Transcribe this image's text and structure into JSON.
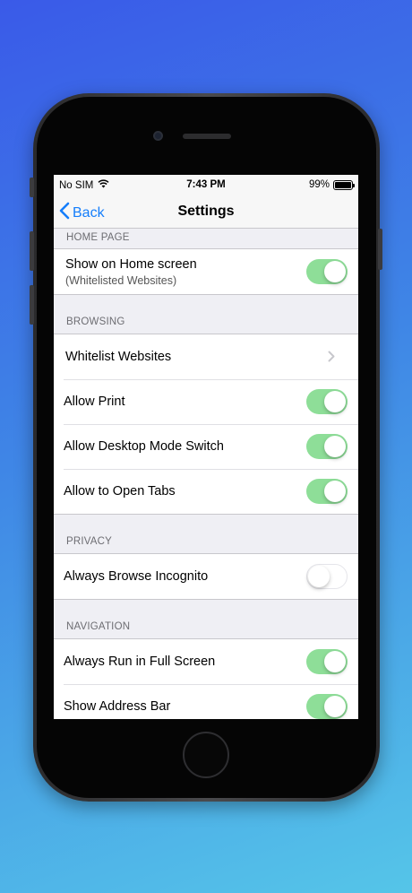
{
  "status_bar": {
    "carrier": "No SIM",
    "time": "7:43 PM",
    "battery": "99%",
    "wifi_icon": "wifi-icon",
    "battery_icon": "battery-icon"
  },
  "nav_bar": {
    "back_label": "Back",
    "title": "Settings"
  },
  "sections": {
    "home_page": {
      "header": "HOME PAGE",
      "show_on_home": {
        "label": "Show on Home screen",
        "sublabel": "(Whitelisted Websites)",
        "on": true
      }
    },
    "browsing": {
      "header": "BROWSING",
      "whitelist": {
        "label": "Whitelist Websites"
      },
      "allow_print": {
        "label": "Allow Print",
        "on": true
      },
      "allow_desktop": {
        "label": "Allow Desktop Mode Switch",
        "on": true
      },
      "allow_tabs": {
        "label": "Allow to Open Tabs",
        "on": true
      }
    },
    "privacy": {
      "header": "PRIVACY",
      "incognito": {
        "label": "Always Browse Incognito",
        "on": false
      }
    },
    "navigation": {
      "header": "NAVIGATION",
      "full_screen": {
        "label": "Always Run in Full Screen",
        "on": true
      },
      "address_bar": {
        "label": "Show Address Bar",
        "on": true
      }
    }
  },
  "colors": {
    "accent": "#157efb",
    "toggle_on": "#8ede98",
    "background": "#efeff4"
  }
}
